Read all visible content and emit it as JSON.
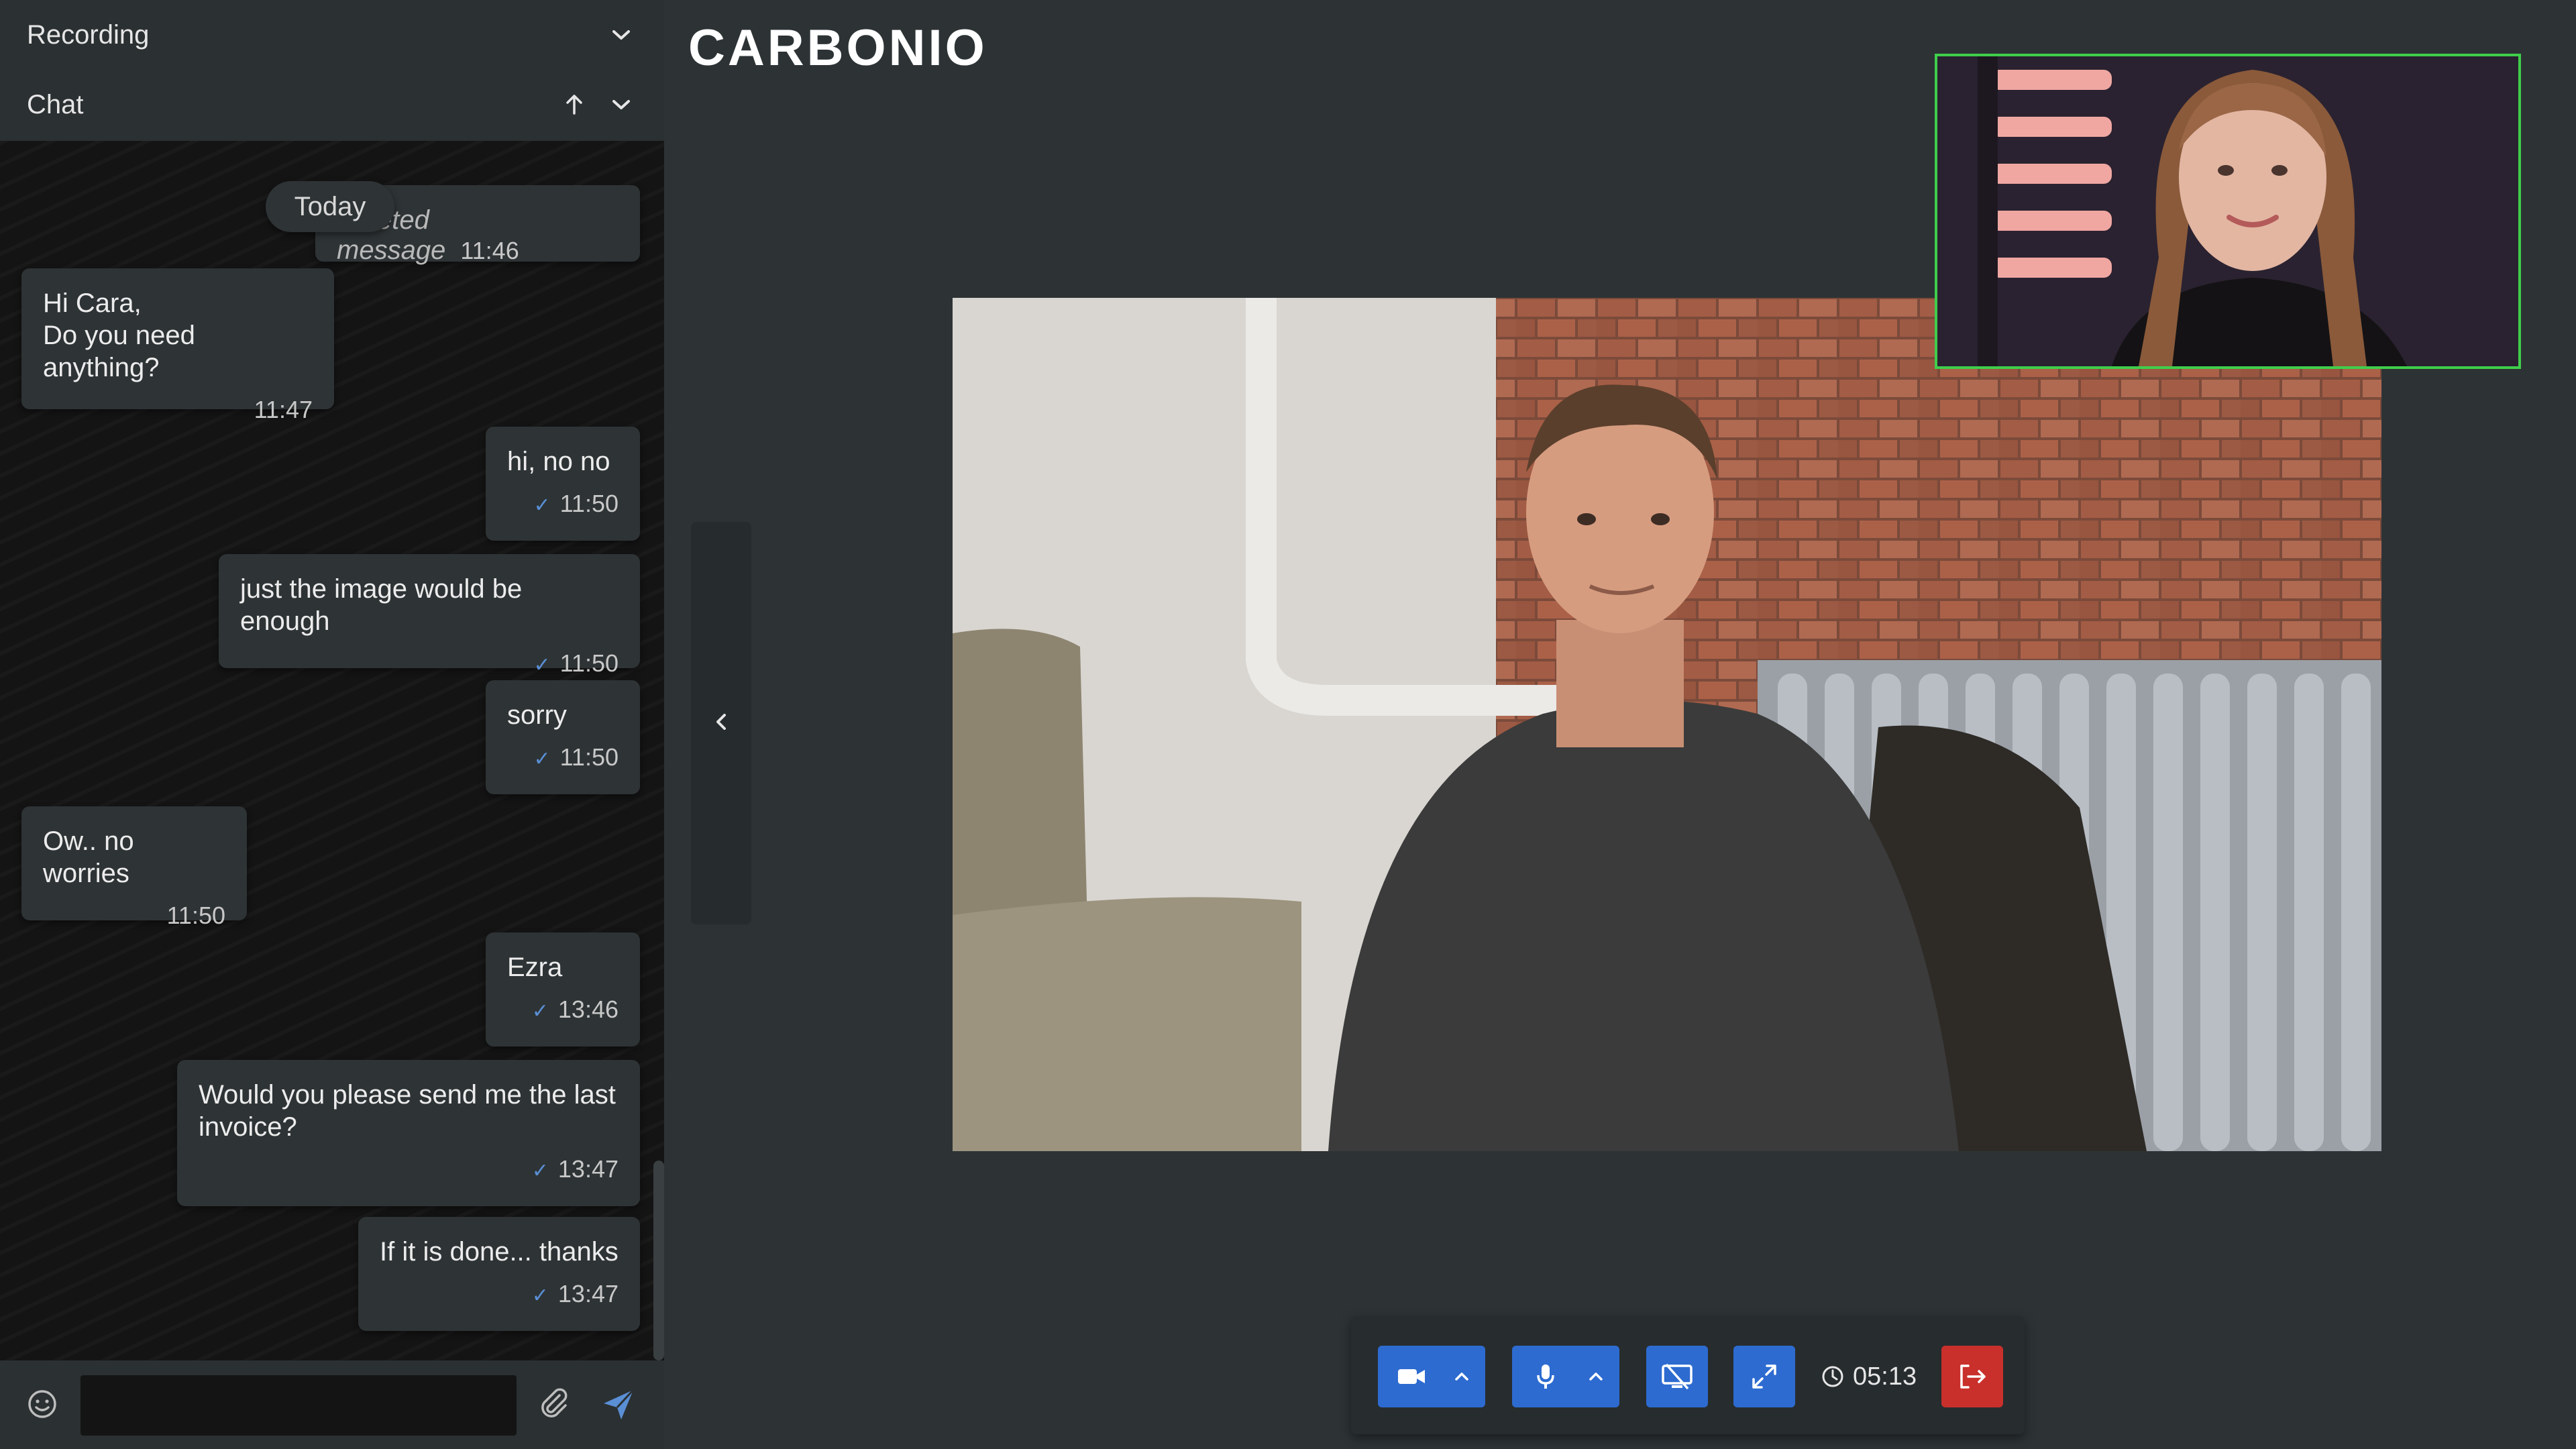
{
  "sidebar": {
    "recording": {
      "label": "Recording"
    },
    "chat": {
      "label": "Chat"
    },
    "today_label": "Today",
    "messages": [
      {
        "type": "deleted",
        "text": "Deleted message",
        "time": "11:46"
      },
      {
        "direction": "in",
        "lines": [
          "Hi Cara,",
          "Do you need anything?"
        ],
        "time": "11:47"
      },
      {
        "direction": "out",
        "text": "hi, no no",
        "time": "11:50"
      },
      {
        "direction": "out",
        "text": "just the image would be enough",
        "time": "11:50"
      },
      {
        "direction": "out",
        "text": "sorry",
        "time": "11:50"
      },
      {
        "direction": "in",
        "text": "Ow.. no worries",
        "time": "11:50"
      },
      {
        "direction": "out",
        "text": "Ezra",
        "time": "13:46"
      },
      {
        "direction": "out",
        "lines": [
          "Would you please send me the last",
          "invoice?"
        ],
        "time": "13:47"
      },
      {
        "direction": "out",
        "text": "If it is done... thanks",
        "time": "13:47"
      }
    ],
    "composer": {
      "value": "",
      "placeholder": ""
    }
  },
  "header": {
    "logo": "CARBONIO"
  },
  "call": {
    "timer": "05:13",
    "active_speaker_color": "#3fce4b"
  },
  "colors": {
    "accent": "#2d6bd0",
    "leave": "#c9302c",
    "read_check": "#5a8fd6"
  }
}
